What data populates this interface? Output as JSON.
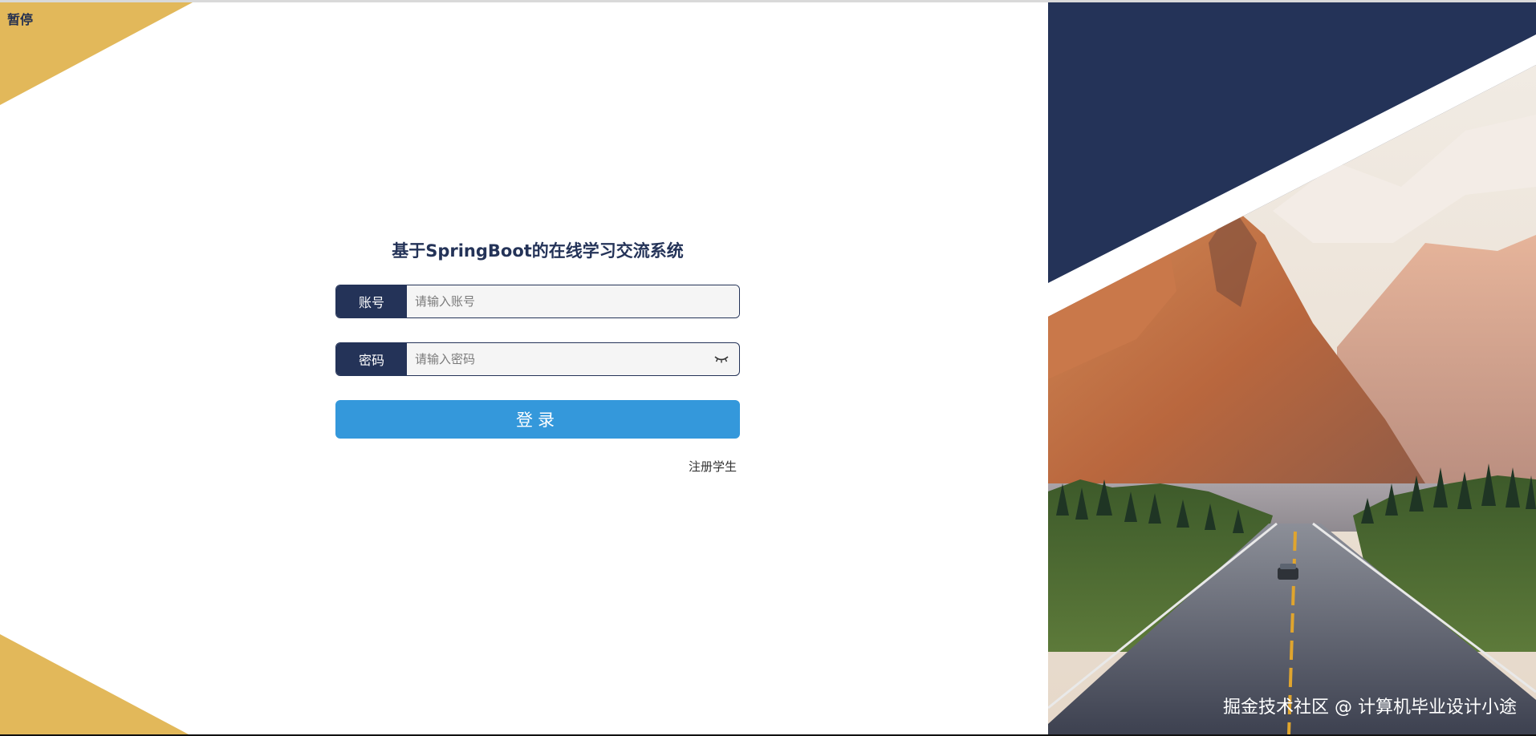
{
  "overlay": {
    "pause_label": "暂停"
  },
  "login": {
    "title": "基于SpringBoot的在线学习交流系统",
    "account_label": "账号",
    "account_placeholder": "请输入账号",
    "password_label": "密码",
    "password_placeholder": "请输入密码",
    "submit_label": "登录",
    "register_link": "注册学生"
  },
  "hero": {
    "watermark": "掘金技术社区 @ 计算机毕业设计小途"
  },
  "colors": {
    "navy": "#243358",
    "accent_blue": "#3498db",
    "gold": "#e2b85a"
  },
  "icons": {
    "password_toggle": "eye-closed-icon"
  }
}
